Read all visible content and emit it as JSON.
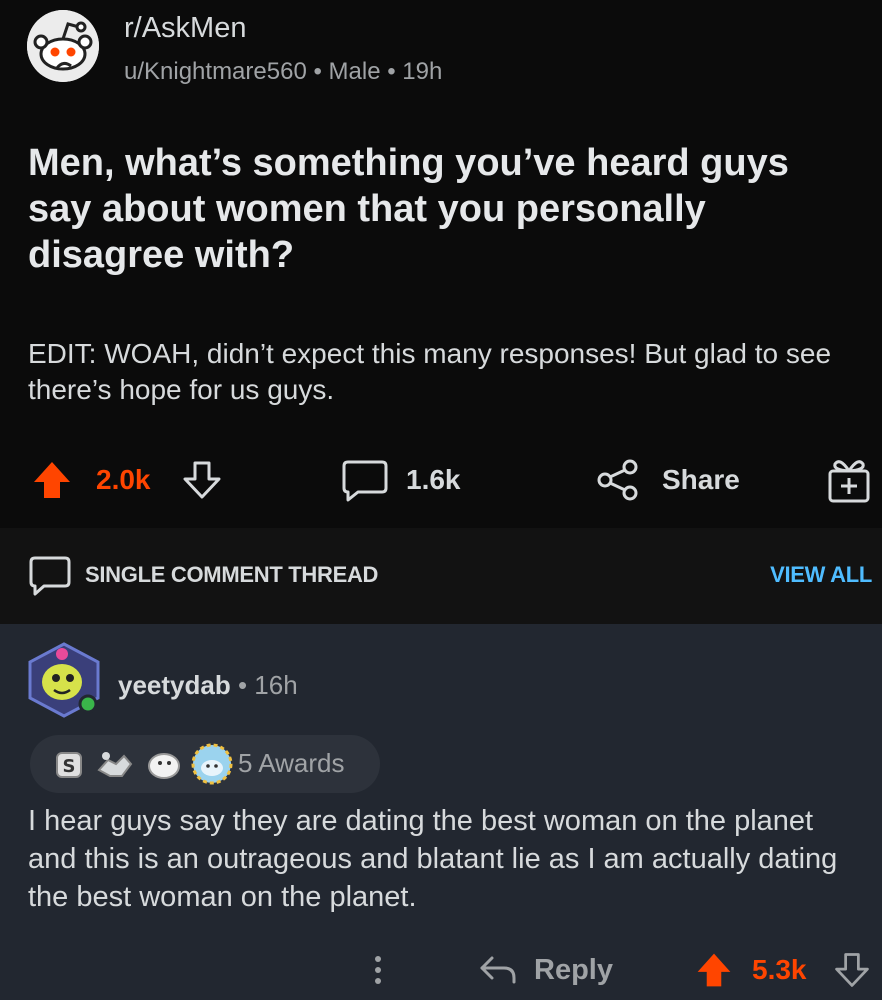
{
  "post": {
    "subreddit": "r/AskMen",
    "meta": "u/Knightmare560 • Male • 19h",
    "title": "Men, what’s something you’ve heard guys say about women that you personally disagree with?",
    "body": "EDIT: WOAH, didn’t expect this many responses! But glad to see there’s hope for us guys.",
    "votes": "2.0k",
    "comments": "1.6k",
    "share_label": "Share"
  },
  "thread": {
    "label": "SINGLE COMMENT THREAD",
    "view_all": "VIEW ALL"
  },
  "comment": {
    "username": "yeetydab",
    "time": " • 16h",
    "awards_label": "5 Awards",
    "body": "I hear guys say they are dating the best woman on the planet and this is an outrageous and blatant lie as I am actually dating the best woman on the planet.",
    "reply_label": "Reply",
    "votes": "5.3k"
  },
  "colors": {
    "upvote": "#ff4500",
    "link": "#4fbcff",
    "post_bg": "#0b0b0b",
    "comment_bg": "#222730"
  }
}
